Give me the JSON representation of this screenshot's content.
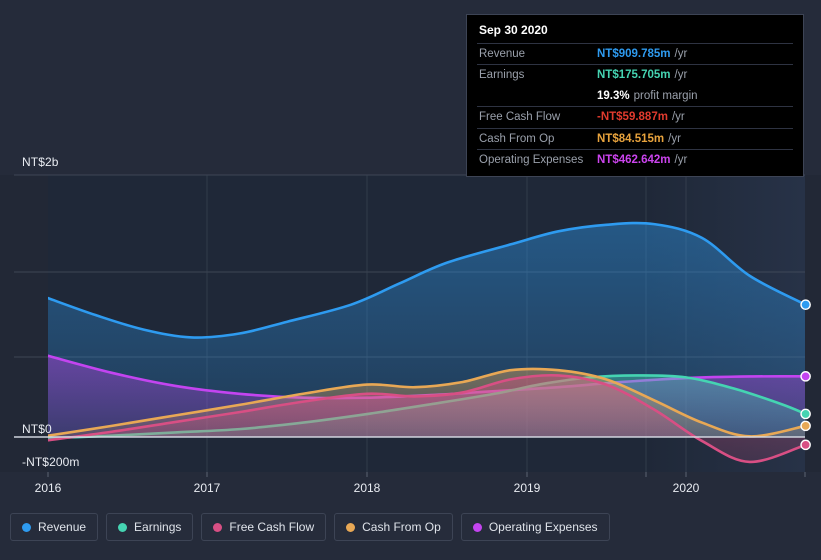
{
  "chart_data": {
    "type": "area",
    "title": "",
    "xlabel": "",
    "ylabel": "",
    "currency": "NT$",
    "grid": true,
    "legend_position": "bottom",
    "x": [
      "2016",
      "2017",
      "2018",
      "2019",
      "2020"
    ],
    "xlim": [
      2015.8,
      2020.95
    ],
    "ylim": [
      -200,
      2000
    ],
    "yticks": [
      {
        "value": 2000,
        "label": "NT$2b"
      },
      {
        "value": 0,
        "label": "NT$0"
      },
      {
        "value": -200,
        "label": "-NT$200m"
      }
    ],
    "series": [
      {
        "name": "Revenue",
        "color": "#2e9bf0",
        "x": [
          2016.0,
          2016.3,
          2016.6,
          2016.9,
          2017.2,
          2017.5,
          2017.9,
          2018.2,
          2018.5,
          2018.9,
          2019.2,
          2019.5,
          2019.8,
          2020.1,
          2020.4,
          2020.75
        ],
        "values": [
          1060,
          930,
          820,
          760,
          790,
          880,
          1010,
          1170,
          1330,
          1470,
          1570,
          1620,
          1625,
          1520,
          1230,
          1010
        ]
      },
      {
        "name": "Earnings",
        "color": "#45d4b2",
        "x": [
          2016.0,
          2016.4,
          2016.8,
          2017.2,
          2017.6,
          2018.0,
          2018.4,
          2018.8,
          2019.1,
          2019.4,
          2019.7,
          2020.0,
          2020.3,
          2020.6,
          2020.75
        ],
        "values": [
          -10,
          10,
          35,
          60,
          110,
          175,
          250,
          330,
          405,
          455,
          470,
          455,
          370,
          250,
          176
        ]
      },
      {
        "name": "Free Cash Flow",
        "color": "#d84f84",
        "x": [
          2016.0,
          2016.4,
          2016.8,
          2017.2,
          2017.6,
          2018.0,
          2018.3,
          2018.6,
          2018.9,
          2019.2,
          2019.5,
          2019.8,
          2020.1,
          2020.4,
          2020.75
        ],
        "values": [
          -25,
          40,
          115,
          190,
          270,
          330,
          310,
          340,
          440,
          470,
          400,
          210,
          -30,
          -190,
          -60
        ]
      },
      {
        "name": "Cash From Op",
        "color": "#e8a855",
        "x": [
          2016.0,
          2016.4,
          2016.8,
          2017.2,
          2017.6,
          2018.0,
          2018.3,
          2018.6,
          2018.9,
          2019.2,
          2019.5,
          2019.8,
          2020.1,
          2020.4,
          2020.75
        ],
        "values": [
          10,
          85,
          165,
          245,
          330,
          400,
          380,
          420,
          510,
          510,
          440,
          280,
          110,
          5,
          85
        ]
      },
      {
        "name": "Operating Expenses",
        "color": "#c344f0",
        "x": [
          2016.0,
          2016.4,
          2016.8,
          2017.2,
          2017.6,
          2018.0,
          2018.4,
          2018.8,
          2019.2,
          2019.6,
          2020.0,
          2020.4,
          2020.75
        ],
        "values": [
          620,
          490,
          390,
          330,
          300,
          300,
          320,
          350,
          380,
          420,
          450,
          462,
          463
        ]
      }
    ]
  },
  "tooltip": {
    "date": "Sep 30 2020",
    "rows": [
      {
        "label": "Revenue",
        "value": "NT$909.785m",
        "unit": "/yr",
        "color": "#2e9bf0"
      },
      {
        "label": "Earnings",
        "value": "NT$175.705m",
        "unit": "/yr",
        "color": "#45d4b2"
      },
      {
        "label": "",
        "value": "19.3%",
        "unit": "profit margin",
        "color": "#ffffff"
      },
      {
        "label": "Free Cash Flow",
        "value": "-NT$59.887m",
        "unit": "/yr",
        "color": "#e23b2e"
      },
      {
        "label": "Cash From Op",
        "value": "NT$84.515m",
        "unit": "/yr",
        "color": "#e8a33d"
      },
      {
        "label": "Operating Expenses",
        "value": "NT$462.642m",
        "unit": "/yr",
        "color": "#cc44ee"
      }
    ]
  },
  "legend": {
    "items": [
      {
        "label": "Revenue",
        "color": "#2e9bf0"
      },
      {
        "label": "Earnings",
        "color": "#45d4b2"
      },
      {
        "label": "Free Cash Flow",
        "color": "#d84f84"
      },
      {
        "label": "Cash From Op",
        "color": "#e8a855"
      },
      {
        "label": "Operating Expenses",
        "color": "#c344f0"
      }
    ]
  },
  "axis": {
    "y_top_label": "NT$2b",
    "y_zero_label": "NT$0",
    "y_bottom_label": "-NT$200m",
    "x_labels": [
      "2016",
      "2017",
      "2018",
      "2019",
      "2020"
    ]
  }
}
